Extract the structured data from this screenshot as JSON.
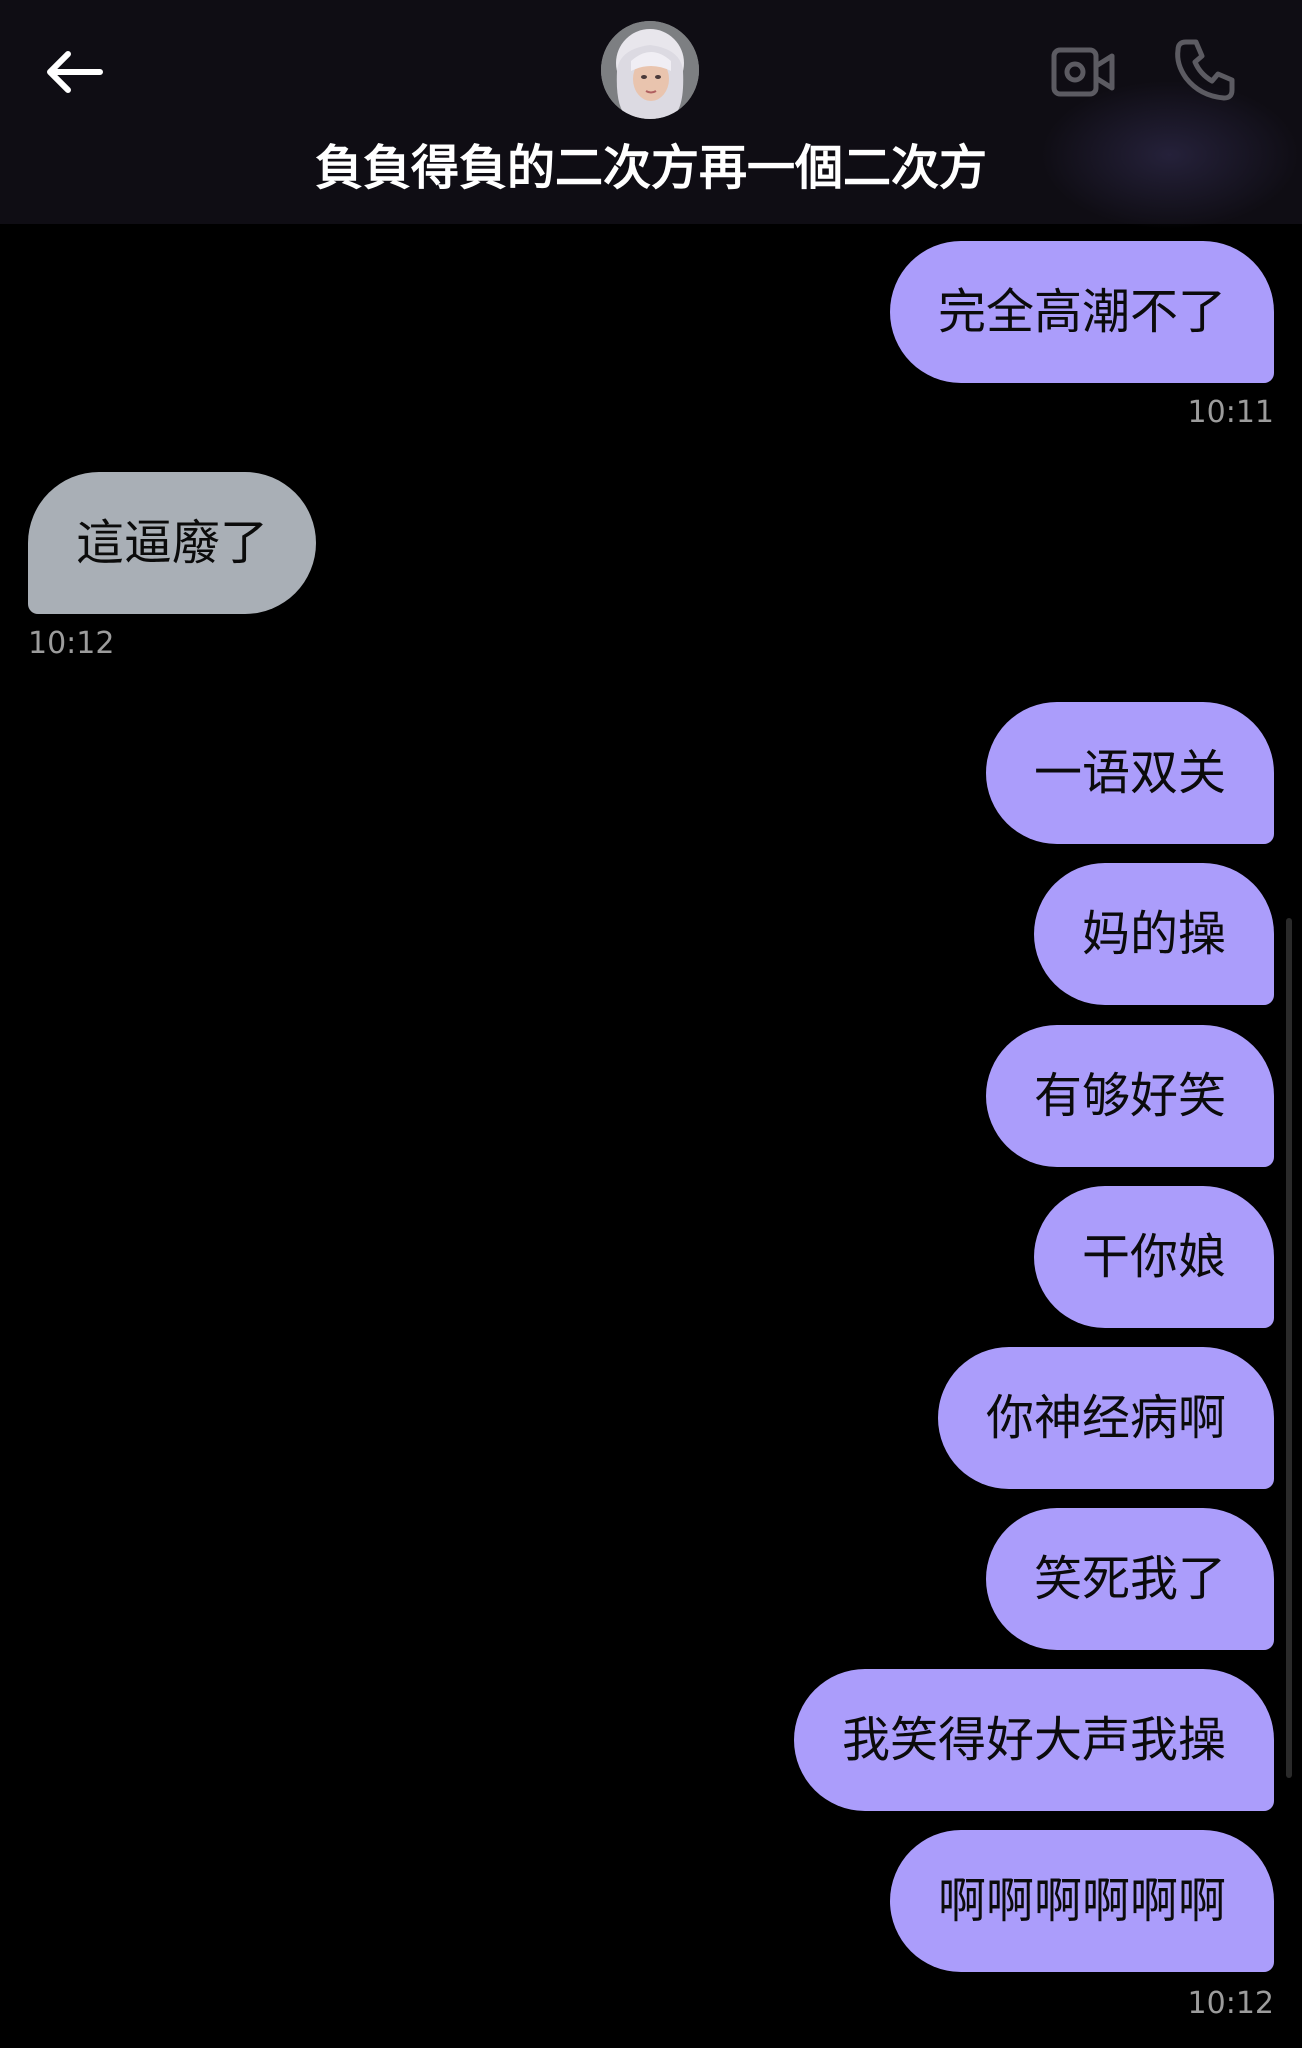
{
  "header": {
    "back_icon": "arrow-left-icon",
    "title": "負負得負的二次方再一個二次方",
    "video_icon": "video-camera-icon",
    "call_icon": "phone-icon",
    "avatar_icon": "contact-avatar"
  },
  "colors": {
    "outgoing_bubble": "#ab9dfb",
    "incoming_bubble": "#a9afb6",
    "background": "#000000",
    "header_background": "#0f0d14",
    "timestamp": "#9c9c9c"
  },
  "messages": [
    {
      "direction": "out",
      "text": "完全高潮不了",
      "time": "10:11"
    },
    {
      "direction": "in",
      "text": "這逼廢了",
      "time": "10:12"
    },
    {
      "direction": "out",
      "text": "一语双关",
      "time": ""
    },
    {
      "direction": "out",
      "text": "妈的操",
      "time": ""
    },
    {
      "direction": "out",
      "text": "有够好笑",
      "time": ""
    },
    {
      "direction": "out",
      "text": "干你娘",
      "time": ""
    },
    {
      "direction": "out",
      "text": "你神经病啊",
      "time": ""
    },
    {
      "direction": "out",
      "text": "笑死我了",
      "time": ""
    },
    {
      "direction": "out",
      "text": "我笑得好大声我操",
      "time": ""
    },
    {
      "direction": "out",
      "text": "啊啊啊啊啊啊",
      "time": "10:12"
    }
  ]
}
